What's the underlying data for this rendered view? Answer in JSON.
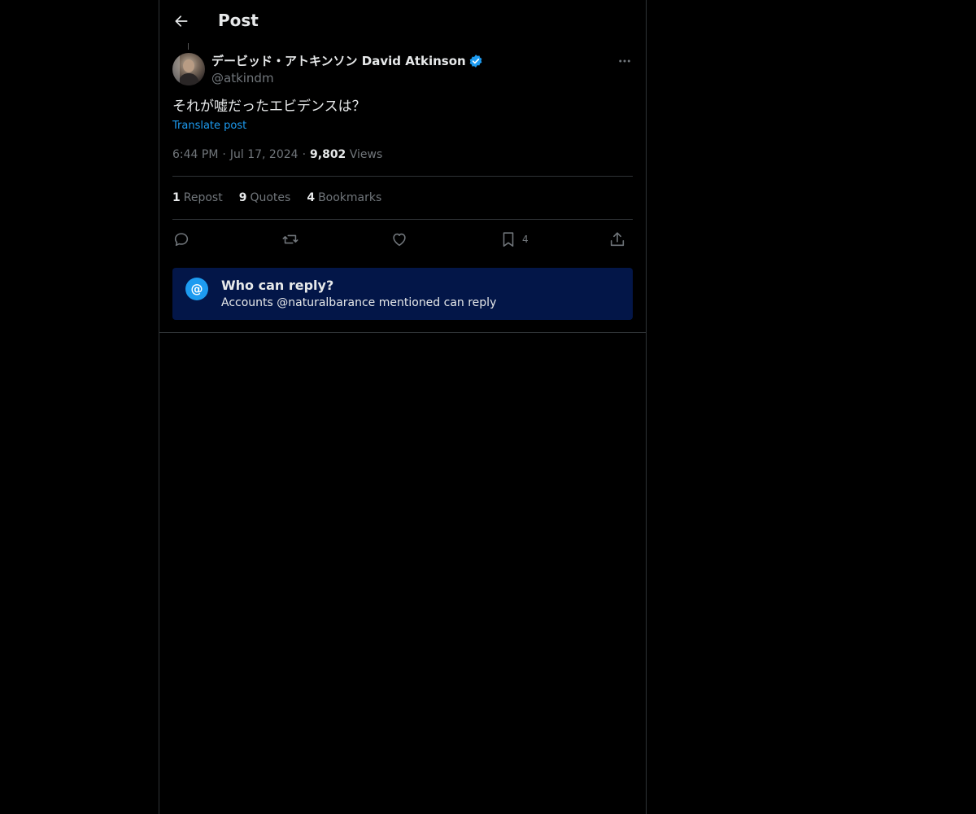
{
  "header": {
    "title": "Post"
  },
  "author": {
    "name": "デービッド・アトキンソン David Atkinson",
    "handle": "@atkindm",
    "verified": true
  },
  "tweet": {
    "text": "それが嘘だったエビデンスは？",
    "translate_label": "Translate post",
    "time": "6:44 PM",
    "date": "Jul 17, 2024",
    "views_count": "9,802",
    "views_label": "Views"
  },
  "stats": {
    "reposts_count": "1",
    "reposts_label": "Repost",
    "quotes_count": "9",
    "quotes_label": "Quotes",
    "bookmarks_count": "4",
    "bookmarks_label": "Bookmarks"
  },
  "actions": {
    "reply_icon": "reply-icon",
    "repost_icon": "repost-icon",
    "like_icon": "heart-icon",
    "bookmark_icon": "bookmark-icon",
    "bookmark_count": "4",
    "share_icon": "share-icon"
  },
  "reply_restriction": {
    "icon": "@",
    "title": "Who can reply?",
    "subtitle": "Accounts @naturalbarance mentioned can reply"
  },
  "colors": {
    "background": "#000000",
    "accent": "#1d9bf0",
    "muted": "#71767b",
    "reply_box": "#031648"
  }
}
